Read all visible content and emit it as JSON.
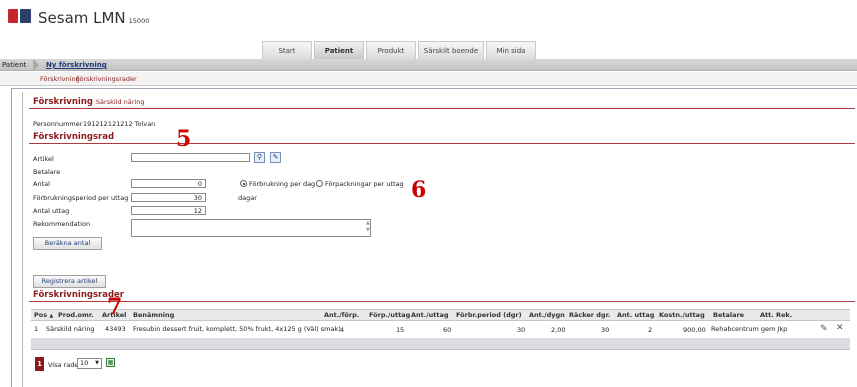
{
  "app": {
    "title": "Sesam LMN",
    "number": "15000"
  },
  "tabs": [
    {
      "label": "Start"
    },
    {
      "label": "Patient"
    },
    {
      "label": "Produkt"
    },
    {
      "label": "Särskilt boende"
    },
    {
      "label": "Min sida"
    }
  ],
  "breadcrumb": {
    "root": "Patient",
    "current": "Ny förskrivning"
  },
  "subnav": {
    "item1": "Förskrivning",
    "item2": "Förskrivningsrader"
  },
  "forskrivning": {
    "title": "Förskrivning",
    "subtitle": "Särskild näring"
  },
  "person": {
    "label": "Personnummer",
    "value": "191212121212 Tolvan"
  },
  "rad": {
    "title": "Förskrivningsrad",
    "artikel_label": "Artikel",
    "artikel_value": "",
    "betalare_label": "Betalare",
    "antal_label": "Antal",
    "antal_value": "0",
    "radio1": "Förbrukning per dag",
    "radio2": "Förpackningar per uttag",
    "period_label": "Förbrukningsperiod per uttag",
    "period_value": "30",
    "period_unit": "dagar",
    "uttag_label": "Antal uttag",
    "uttag_value": "12",
    "rek_label": "Rekommendation",
    "berakna_button": "Beräkna antal",
    "registrera_button": "Registrera artikel"
  },
  "rader": {
    "title": "Förskrivningsrader",
    "headers": [
      "Pos",
      "Prod.omr.",
      "Artikel",
      "Benämning",
      "Ant./förp.",
      "Förp./uttag",
      "Ant./uttag",
      "Förbr.period (dgr)",
      "Ant./dygn",
      "Räcker dgr.",
      "Ant. uttag",
      "Kostn./uttag",
      "Betalare",
      "Att.",
      "Rek."
    ],
    "row": [
      "1",
      "Särskild näring",
      "43493",
      "Fresubin dessert fruit, komplett, 50% frukt, 4x125 g (Väl) smak)",
      "4",
      "15",
      "60",
      "30",
      "2,00",
      "30",
      "2",
      "900,00",
      "Rehabcentrum gem Jkp"
    ]
  },
  "pager": {
    "page": "1",
    "visa_label": "Visa rader",
    "visa_value": "10"
  },
  "annotations": {
    "n5": "5",
    "n6": "6",
    "n7": "7"
  }
}
